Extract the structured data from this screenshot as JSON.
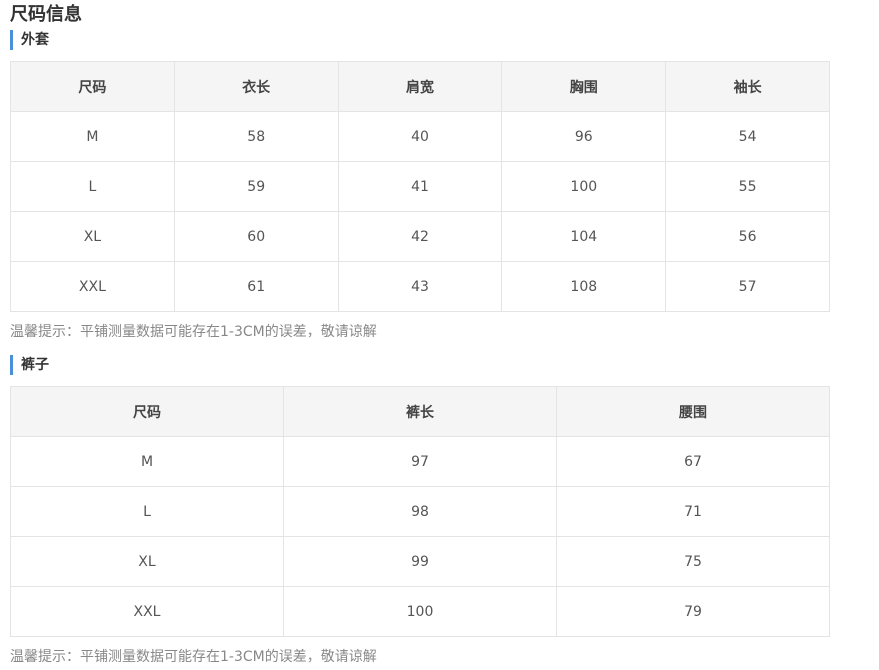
{
  "title": "尺码信息",
  "jacket": {
    "title": "外套",
    "headers": [
      "尺码",
      "衣长",
      "肩宽",
      "胸围",
      "袖长"
    ],
    "rows": [
      [
        "M",
        "58",
        "40",
        "96",
        "54"
      ],
      [
        "L",
        "59",
        "41",
        "100",
        "55"
      ],
      [
        "XL",
        "60",
        "42",
        "104",
        "56"
      ],
      [
        "XXL",
        "61",
        "43",
        "108",
        "57"
      ]
    ],
    "note": "温馨提示：平铺测量数据可能存在1-3CM的误差，敬请谅解"
  },
  "pants": {
    "title": "裤子",
    "headers": [
      "尺码",
      "裤长",
      "腰围"
    ],
    "rows": [
      [
        "M",
        "97",
        "67"
      ],
      [
        "L",
        "98",
        "71"
      ],
      [
        "XL",
        "99",
        "75"
      ],
      [
        "XXL",
        "100",
        "79"
      ]
    ],
    "note": "温馨提示：平铺测量数据可能存在1-3CM的误差，敬请谅解"
  },
  "colors": {
    "accent": "#4a90d9",
    "header_bg": "#f5f5f5",
    "border": "#e4e4e4"
  }
}
